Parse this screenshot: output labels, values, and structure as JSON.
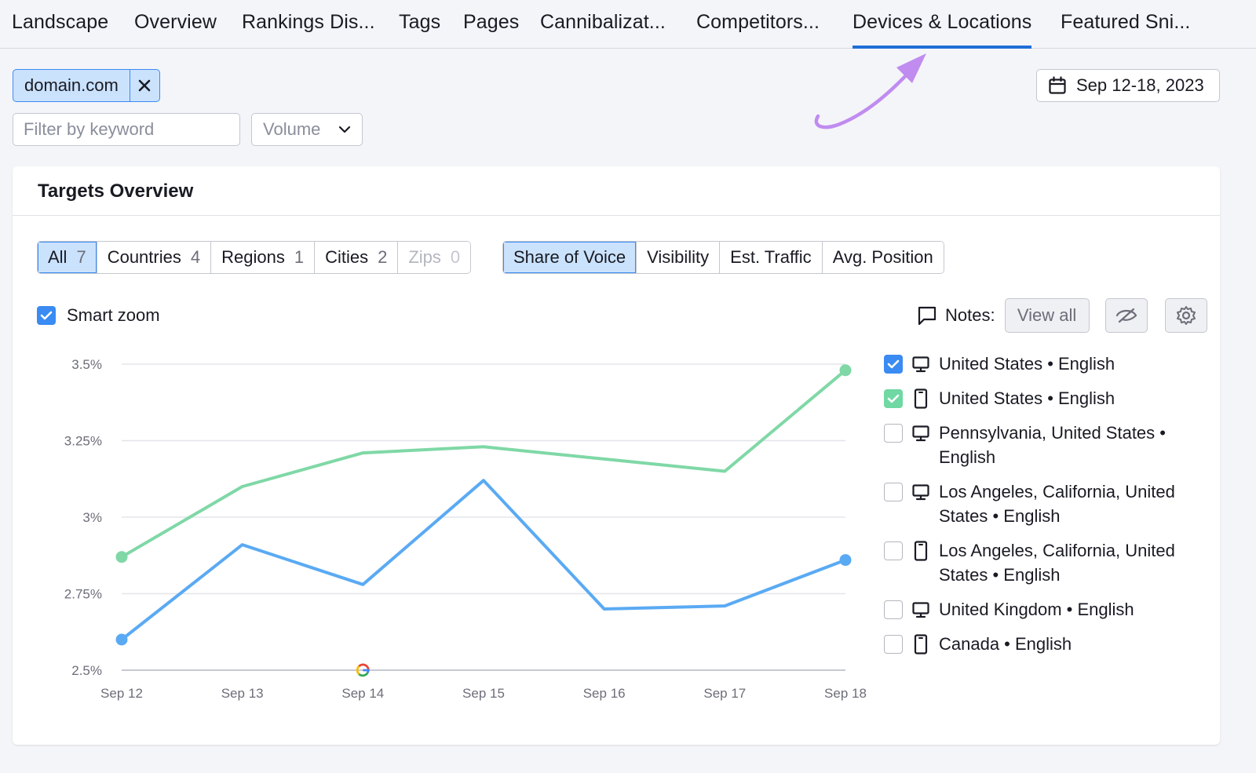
{
  "tabs": [
    {
      "label": "Landscape",
      "active": false
    },
    {
      "label": "Overview",
      "active": false
    },
    {
      "label": "Rankings Dis...",
      "active": false
    },
    {
      "label": "Tags",
      "active": false
    },
    {
      "label": "Pages",
      "active": false
    },
    {
      "label": "Cannibalizat...",
      "active": false
    },
    {
      "label": "Competitors...",
      "active": false
    },
    {
      "label": "Devices & Locations",
      "active": true
    },
    {
      "label": "Featured Sni...",
      "active": false
    }
  ],
  "domain_chip": {
    "label": "domain.com"
  },
  "filter": {
    "placeholder": "Filter by keyword",
    "value": ""
  },
  "volume_dropdown": {
    "label": "Volume"
  },
  "date_range": {
    "label": "Sep 12-18, 2023"
  },
  "card": {
    "title": "Targets Overview"
  },
  "target_filters": [
    {
      "label": "All",
      "count": "7",
      "active": true,
      "disabled": false
    },
    {
      "label": "Countries",
      "count": "4",
      "active": false,
      "disabled": false
    },
    {
      "label": "Regions",
      "count": "1",
      "active": false,
      "disabled": false
    },
    {
      "label": "Cities",
      "count": "2",
      "active": false,
      "disabled": false
    },
    {
      "label": "Zips",
      "count": "0",
      "active": false,
      "disabled": true
    }
  ],
  "metric_tabs": [
    {
      "label": "Share of Voice",
      "active": true
    },
    {
      "label": "Visibility",
      "active": false
    },
    {
      "label": "Est. Traffic",
      "active": false
    },
    {
      "label": "Avg. Position",
      "active": false
    }
  ],
  "smart_zoom": {
    "label": "Smart zoom",
    "checked": true
  },
  "notes": {
    "label": "Notes:",
    "view_all": "View all"
  },
  "colors": {
    "accent": "#3a8bf2",
    "active_bg": "#cbe2fd",
    "series_blue": "#5aaaf3",
    "series_green": "#7fd8a6",
    "arrow": "#c08cf0"
  },
  "legend": [
    {
      "label": "United States • English",
      "device": "desktop-icon",
      "checked": true,
      "check_color": "#3a8bf2"
    },
    {
      "label": "United States • English",
      "device": "mobile-icon",
      "checked": true,
      "check_color": "#6fd8a3"
    },
    {
      "label": "Pennsylvania, United States • English",
      "device": "desktop-icon",
      "checked": false
    },
    {
      "label": "Los Angeles, California, United States • English",
      "device": "desktop-icon",
      "checked": false
    },
    {
      "label": "Los Angeles, California, United States • English",
      "device": "mobile-icon",
      "checked": false
    },
    {
      "label": "United Kingdom • English",
      "device": "desktop-icon",
      "checked": false
    },
    {
      "label": "Canada • English",
      "device": "mobile-icon",
      "checked": false
    }
  ],
  "chart_data": {
    "type": "line",
    "categories": [
      "Sep 12",
      "Sep 13",
      "Sep 14",
      "Sep 15",
      "Sep 16",
      "Sep 17",
      "Sep 18"
    ],
    "y_ticks": [
      "3.5%",
      "3.25%",
      "3%",
      "2.75%",
      "2.5%"
    ],
    "ylim": [
      2.5,
      3.5
    ],
    "series": [
      {
        "values": [
          2.87,
          3.1,
          3.21,
          3.23,
          3.19,
          3.15,
          3.48
        ],
        "color": "#7fd8a6"
      },
      {
        "values": [
          2.6,
          2.91,
          2.78,
          3.12,
          2.7,
          2.71,
          2.86
        ],
        "color": "#5aaaf3"
      }
    ],
    "grid": true,
    "marker": {
      "category": "Sep 14",
      "icon": "google-icon"
    }
  }
}
